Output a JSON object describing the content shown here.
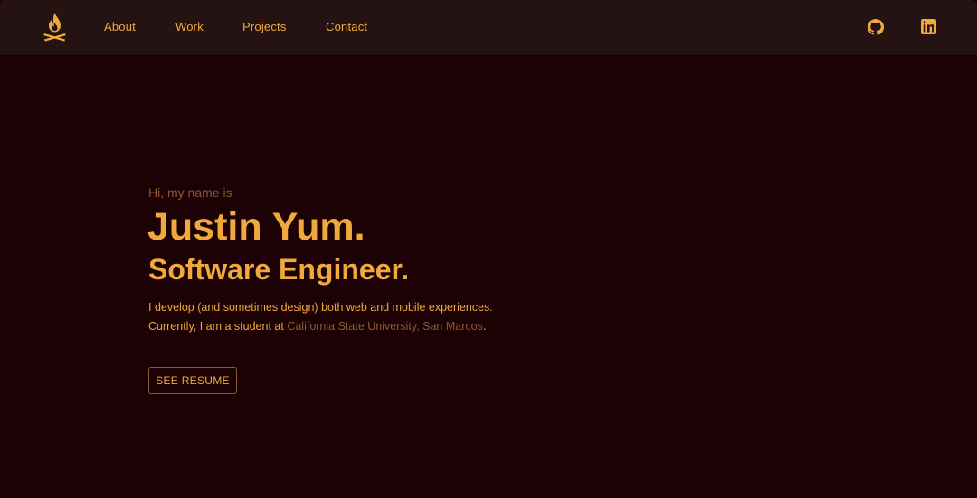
{
  "colors": {
    "background": "#1c0204",
    "navbar": "#251314",
    "accent": "#f0a93c",
    "muted": "#8a5a35"
  },
  "navbar": {
    "logo_icon": "campfire-icon",
    "links": [
      {
        "label": "About"
      },
      {
        "label": "Work"
      },
      {
        "label": "Projects"
      },
      {
        "label": "Contact"
      }
    ],
    "social": [
      {
        "icon": "github-icon"
      },
      {
        "icon": "linkedin-icon"
      }
    ]
  },
  "hero": {
    "greeting": "Hi, my name is",
    "name": "Justin Yum.",
    "role": "Software Engineer.",
    "description_line1": "I develop (and sometimes design) both web and mobile experiences.",
    "description_line2_prefix": "Currently, I am a student at ",
    "school": "California State University, San Marcos",
    "description_line2_suffix": ".",
    "resume_button": "SEE RESUME"
  }
}
